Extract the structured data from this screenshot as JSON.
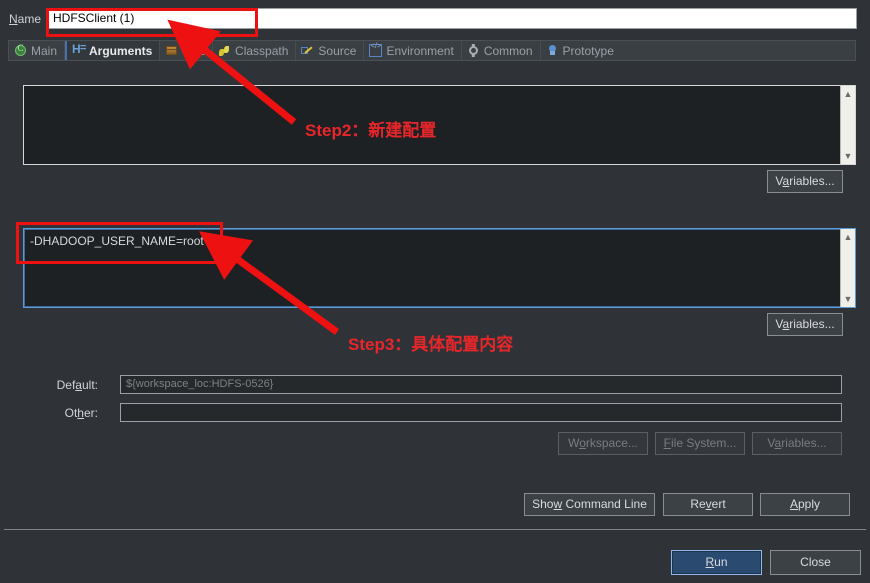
{
  "dialog": {
    "name_label": "Name",
    "name_value": "HDFSClient (1)"
  },
  "tabs": [
    {
      "label": "Main",
      "icon": "class-main-icon",
      "selected": false
    },
    {
      "label": "Arguments",
      "icon": "arguments-icon",
      "selected": true
    },
    {
      "label": "JRE",
      "icon": "jre-icon",
      "selected": false
    },
    {
      "label": "Classpath",
      "icon": "classpath-icon",
      "selected": false
    },
    {
      "label": "Source",
      "icon": "source-icon",
      "selected": false
    },
    {
      "label": "Environment",
      "icon": "environment-icon",
      "selected": false
    },
    {
      "label": "Common",
      "icon": "gear-icon",
      "selected": false
    },
    {
      "label": "Prototype",
      "icon": "lightbulb-icon",
      "selected": false
    }
  ],
  "program_arguments": {
    "value": "",
    "variables_button": "Variables..."
  },
  "vm_arguments": {
    "value": "-DHADOOP_USER_NAME=root",
    "variables_button": "Variables..."
  },
  "working_directory": {
    "default_label": "Default:",
    "default_value": "${workspace_loc:HDFS-0526}",
    "other_label": "Other:",
    "other_value": "",
    "workspace_button": "Workspace...",
    "file_system_button": "File System...",
    "variables_button": "Variables..."
  },
  "footer": {
    "show_command_line": "Show Command Line",
    "revert": "Revert",
    "apply": "Apply",
    "run": "Run",
    "close": "Close"
  },
  "annotations": [
    {
      "text": "Step2：新建配置",
      "color": "#e8262a"
    },
    {
      "text": "Step3：具体配置内容",
      "color": "#e8262a"
    }
  ],
  "colors": {
    "background": "#2f3337",
    "accent_blue": "#5b9bd5",
    "annotation_red": "#ee1111",
    "default_button_fill": "#2b4a70"
  }
}
